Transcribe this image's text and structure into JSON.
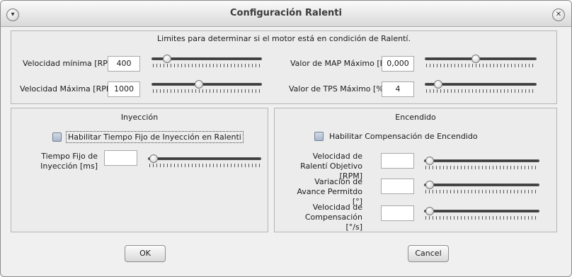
{
  "window": {
    "title": "Configuración Ralenti"
  },
  "limits": {
    "heading": "Limites para determinar si el motor está en condición de Ralentí.",
    "vel_min": {
      "label": "Velocidad mínima [RPM]",
      "value": "400",
      "slider": 0.1
    },
    "vel_max": {
      "label": "Velocidad Máxima [RPM]",
      "value": "1000",
      "slider": 0.42
    },
    "map_max": {
      "label": "Valor de MAP Máximo [B]",
      "value": "0,000",
      "slider": 0.45
    },
    "tps_max": {
      "label": "Valor de TPS Máximo [%]",
      "value": "4",
      "slider": 0.08
    }
  },
  "injection": {
    "heading": "Inyección",
    "checkbox": "Habilitar Tiempo Fijo de Inyección en Ralenti",
    "fixed_time": {
      "label": "Tiempo Fijo de Inyección [ms]",
      "value": "",
      "slider": 0.0
    }
  },
  "ignition": {
    "heading": "Encendido",
    "checkbox": "Habilitar Compensación de Encendido",
    "target_speed": {
      "label": "Velocidad de Ralentí Objetivo [RPM]",
      "value": "",
      "slider": 0.0
    },
    "advance_var": {
      "label": "Variación de Avance Permitdo [°]",
      "value": "",
      "slider": 0.0
    },
    "comp_speed": {
      "label": "Velocidad de Compensación [°/s]",
      "value": "",
      "slider": 0.0
    }
  },
  "buttons": {
    "ok": "OK",
    "cancel": "Cancel"
  }
}
